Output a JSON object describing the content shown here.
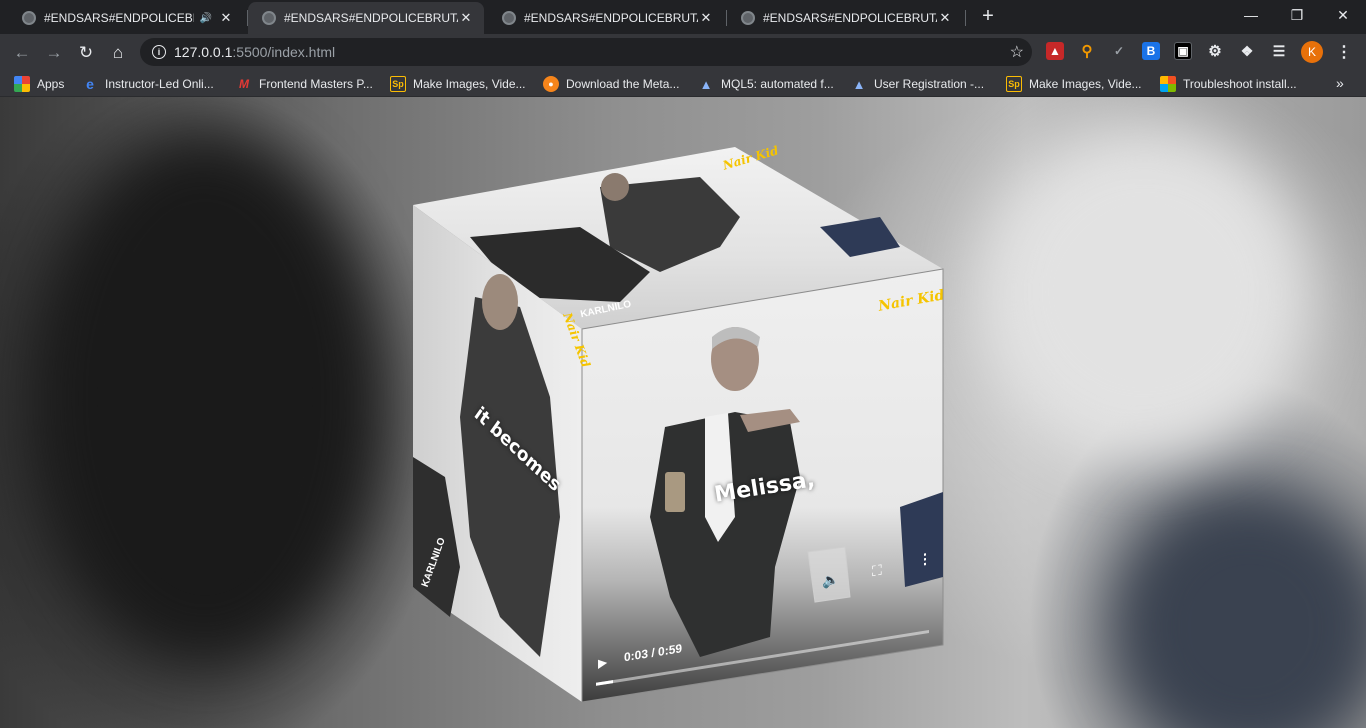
{
  "tabs": [
    {
      "title": "#ENDSARS#ENDPOLICEBRUTALITY",
      "audio": true,
      "active": false
    },
    {
      "title": "#ENDSARS#ENDPOLICEBRUTALITY",
      "audio": false,
      "active": true
    },
    {
      "title": "#ENDSARS#ENDPOLICEBRUTALITY",
      "audio": false,
      "active": false
    },
    {
      "title": "#ENDSARS#ENDPOLICEBRUTALITY",
      "audio": false,
      "active": false
    }
  ],
  "address": {
    "host": "127.0.0.1",
    "rest": ":5500/index.html"
  },
  "profile_initial": "K",
  "bookmarks": [
    {
      "label": "Apps",
      "icon": "apps-grid-icon"
    },
    {
      "label": "Instructor-Led Onli...",
      "icon": "e-logo-icon"
    },
    {
      "label": "Frontend Masters P...",
      "icon": "frontend-masters-icon"
    },
    {
      "label": "Make Images, Vide...",
      "icon": "sp-icon"
    },
    {
      "label": "Download the Meta...",
      "icon": "metamask-icon"
    },
    {
      "label": "MQL5: automated f...",
      "icon": "graduation-cap-icon"
    },
    {
      "label": "User Registration -...",
      "icon": "graduation-cap-icon"
    },
    {
      "label": "Make Images, Vide...",
      "icon": "sp-icon"
    },
    {
      "label": "Troubleshoot install...",
      "icon": "microsoft-icon"
    }
  ],
  "cube": {
    "left_caption": "it becomes",
    "front_caption": "Melissa,",
    "brand": "Nair Kid",
    "watermark": "KARLNILO",
    "video": {
      "time": "0:03 / 0:59",
      "progress": 0.05
    }
  },
  "colors": {
    "tabstrip": "#202124",
    "toolbar": "#35363a",
    "accent": "#e8710a",
    "brand_yellow": "#f5c400"
  }
}
